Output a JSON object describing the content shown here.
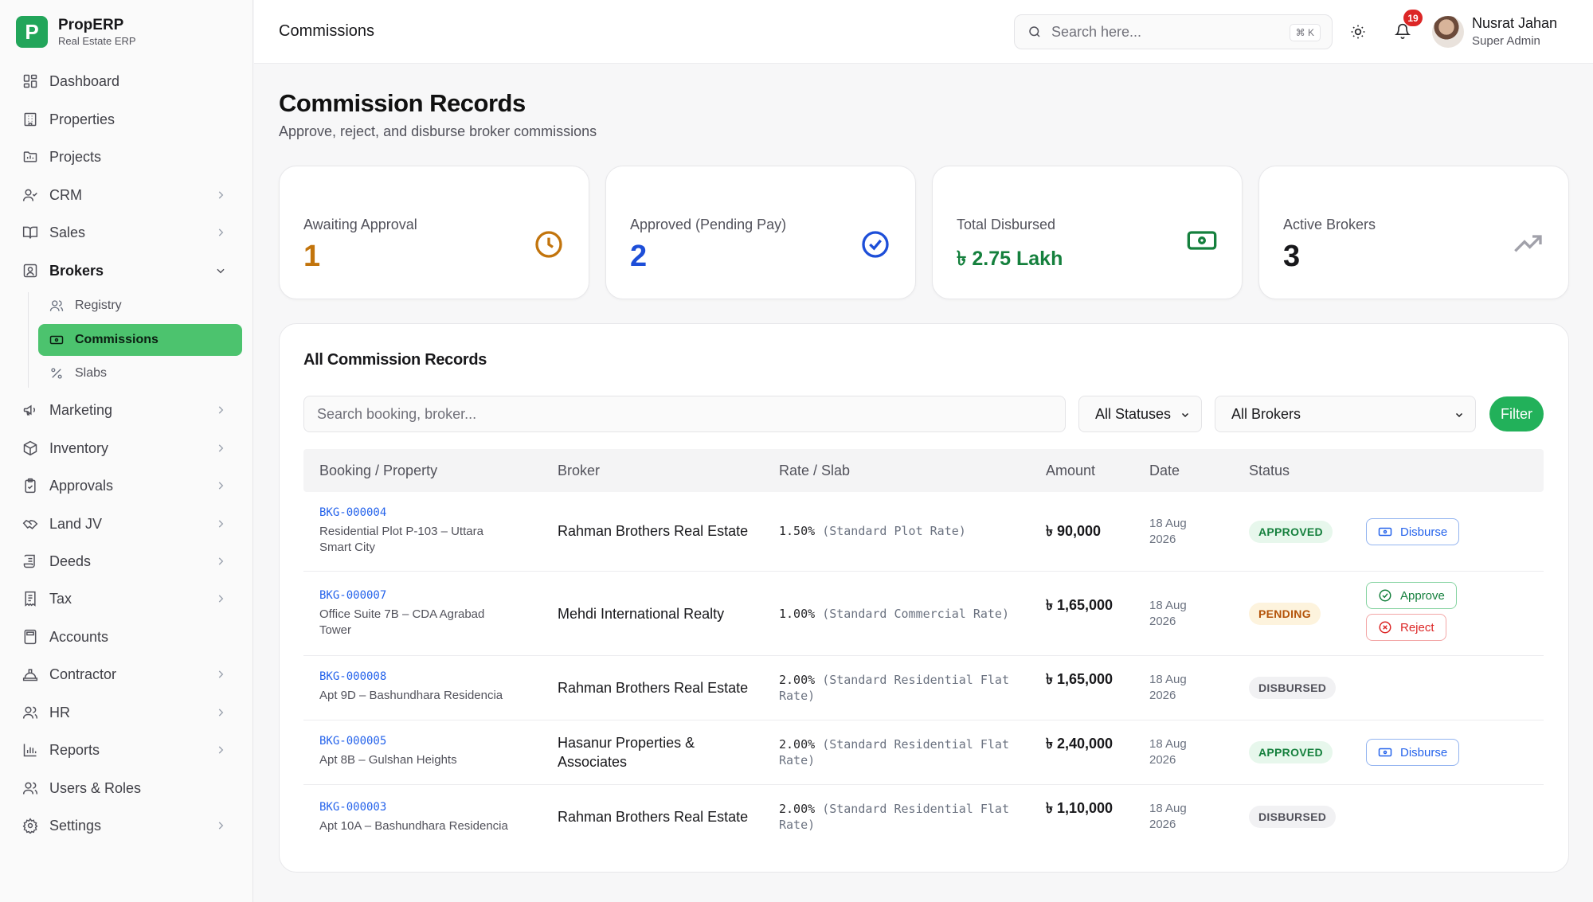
{
  "brand": {
    "logo": "P",
    "name": "PropERP",
    "subtitle": "Real Estate ERP"
  },
  "sidebar": {
    "items": [
      {
        "label": "Dashboard",
        "icon": "dashboard-icon"
      },
      {
        "label": "Properties",
        "icon": "building-icon"
      },
      {
        "label": "Projects",
        "icon": "folder-icon"
      },
      {
        "label": "CRM",
        "icon": "user-check-icon"
      },
      {
        "label": "Sales",
        "icon": "book-icon"
      },
      {
        "label": "Brokers",
        "icon": "broker-badge-icon"
      },
      {
        "label": "Marketing",
        "icon": "megaphone-icon"
      },
      {
        "label": "Inventory",
        "icon": "package-icon"
      },
      {
        "label": "Approvals",
        "icon": "clipboard-check-icon"
      },
      {
        "label": "Land JV",
        "icon": "handshake-icon"
      },
      {
        "label": "Deeds",
        "icon": "scroll-icon"
      },
      {
        "label": "Tax",
        "icon": "receipt-icon"
      },
      {
        "label": "Accounts",
        "icon": "calculator-icon"
      },
      {
        "label": "Contractor",
        "icon": "hard-hat-icon"
      },
      {
        "label": "HR",
        "icon": "users-icon"
      },
      {
        "label": "Reports",
        "icon": "bar-chart-icon"
      },
      {
        "label": "Users & Roles",
        "icon": "user-cog-icon"
      },
      {
        "label": "Settings",
        "icon": "gear-icon"
      }
    ],
    "brokers_sub": [
      {
        "label": "Registry",
        "icon": "users-icon"
      },
      {
        "label": "Commissions",
        "icon": "banknote-icon"
      },
      {
        "label": "Slabs",
        "icon": "percent-icon"
      }
    ]
  },
  "topbar": {
    "title": "Commissions",
    "search_placeholder": "Search here...",
    "search_shortcut": "⌘ K",
    "notification_count": "19",
    "user_name": "Nusrat Jahan",
    "user_role": "Super Admin"
  },
  "page": {
    "title": "Commission Records",
    "subtitle": "Approve, reject, and disburse broker commissions"
  },
  "stats": [
    {
      "label": "Awaiting Approval",
      "value": "1",
      "color": "#c2740c",
      "icon": "clock-icon"
    },
    {
      "label": "Approved (Pending Pay)",
      "value": "2",
      "color": "#1d4ed8",
      "icon": "check-circle-icon"
    },
    {
      "label": "Total Disbursed",
      "value": "৳ 2.75 Lakh",
      "color": "#15803d",
      "icon": "banknote-icon"
    },
    {
      "label": "Active Brokers",
      "value": "3",
      "color": "#18181b",
      "icon": "trending-up-icon"
    }
  ],
  "records": {
    "title": "All Commission Records",
    "search_placeholder": "Search booking, broker...",
    "status_filter": "All Statuses",
    "broker_filter": "All Brokers",
    "filter_label": "Filter",
    "columns": [
      "Booking / Property",
      "Broker",
      "Rate / Slab",
      "Amount",
      "Date",
      "Status"
    ],
    "rows": [
      {
        "booking": "BKG-000004",
        "property": "Residential Plot P-103 – Uttara Smart City",
        "broker": "Rahman Brothers Real Estate",
        "rate": "1.50%",
        "slab": "(Standard Plot Rate)",
        "amount": "৳ 90,000",
        "date": "18 Aug 2026",
        "status": "APPROVED",
        "actions": [
          "Disburse"
        ]
      },
      {
        "booking": "BKG-000007",
        "property": "Office Suite 7B – CDA Agrabad Tower",
        "broker": "Mehdi International Realty",
        "rate": "1.00%",
        "slab": "(Standard Commercial Rate)",
        "amount": "৳ 1,65,000",
        "date": "18 Aug 2026",
        "status": "PENDING",
        "actions": [
          "Approve",
          "Reject"
        ]
      },
      {
        "booking": "BKG-000008",
        "property": "Apt 9D – Bashundhara Residencia",
        "broker": "Rahman Brothers Real Estate",
        "rate": "2.00%",
        "slab": "(Standard Residential Flat Rate)",
        "amount": "৳ 1,65,000",
        "date": "18 Aug 2026",
        "status": "DISBURSED",
        "actions": []
      },
      {
        "booking": "BKG-000005",
        "property": "Apt 8B – Gulshan Heights",
        "broker": "Hasanur Properties & Associates",
        "rate": "2.00%",
        "slab": "(Standard Residential Flat Rate)",
        "amount": "৳ 2,40,000",
        "date": "18 Aug 2026",
        "status": "APPROVED",
        "actions": [
          "Disburse"
        ]
      },
      {
        "booking": "BKG-000003",
        "property": "Apt 10A – Bashundhara Residencia",
        "broker": "Rahman Brothers Real Estate",
        "rate": "2.00%",
        "slab": "(Standard Residential Flat Rate)",
        "amount": "৳ 1,10,000",
        "date": "18 Aug 2026",
        "status": "DISBURSED",
        "actions": []
      }
    ]
  }
}
